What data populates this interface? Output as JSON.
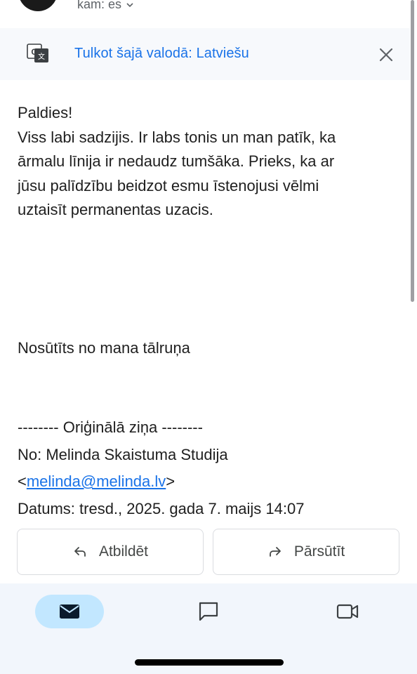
{
  "header": {
    "recipient_label": "kam: es"
  },
  "translate_bar": {
    "text": "Tulkot šajā valodā: Latviešu"
  },
  "message": {
    "lines": [
      "Paldies!",
      "Viss labi sadzijis. Ir labs tonis un man patīk, ka",
      "ārmalu līnija ir nedaudz tumšāka. Prieks, ka ar",
      "jūsu palīdzību beidzot esmu īstenojusi vēlmi",
      "uztaisīt permanentas uzacis."
    ],
    "signature": "Nosūtīts no mana tālruņa",
    "original_header": "-------- Oriģinālā ziņa --------",
    "from_line": "No: Melinda Skaistuma Studija",
    "email_open": "<",
    "email": "melinda@melinda.lv",
    "email_close": ">",
    "date_line": "Datums: tresd., 2025. gada 7. maijs 14:07"
  },
  "actions": {
    "reply_label": "Atbildēt",
    "forward_label": "Pārsūtīt"
  },
  "bottom_nav": {
    "items": [
      {
        "icon": "mail-icon",
        "active": true
      },
      {
        "icon": "chat-icon",
        "active": false
      },
      {
        "icon": "video-icon",
        "active": false
      }
    ]
  },
  "colors": {
    "link": "#1a73e8",
    "nav_active_pill": "#c2e7ff",
    "nav_background": "#f2f6fc"
  }
}
